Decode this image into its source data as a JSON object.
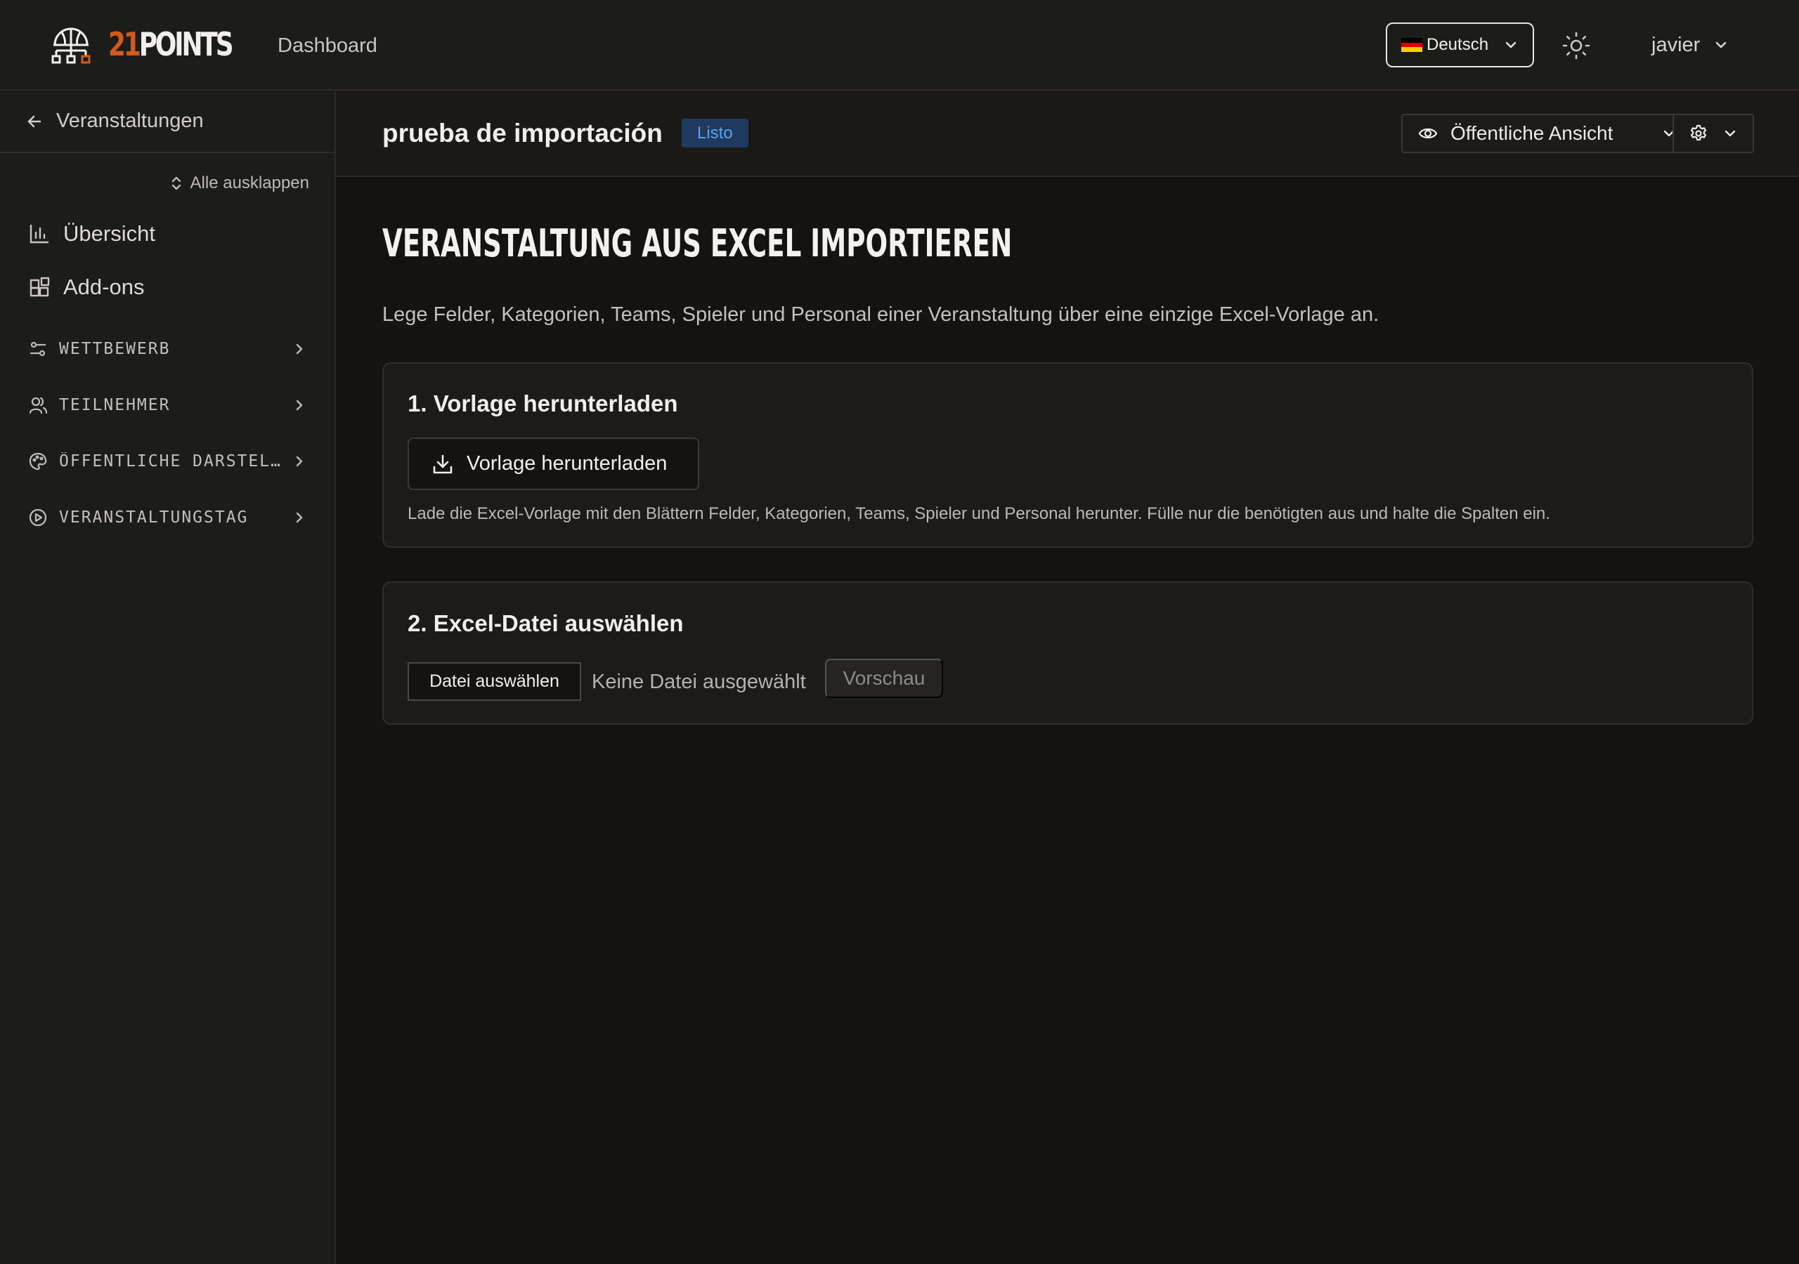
{
  "header": {
    "logo_number": "21",
    "logo_word": "POINTS",
    "nav_dashboard": "Dashboard",
    "language": "Deutsch",
    "user_name": "javier",
    "icons": {
      "logo": "basketball-bracket-icon",
      "theme": "sun-icon",
      "chevron": "chevron-down-icon"
    }
  },
  "sidebar": {
    "back_label": "Veranstaltungen",
    "expand_all": "Alle ausklappen",
    "items": [
      {
        "label": "Übersicht",
        "icon": "bar-chart-icon"
      },
      {
        "label": "Add-ons",
        "icon": "grid-plus-icon"
      }
    ],
    "groups": [
      {
        "label": "WETTBEWERB",
        "icon": "sliders-icon"
      },
      {
        "label": "TEILNEHMER",
        "icon": "users-icon"
      },
      {
        "label": "ÖFFENTLICHE DARSTEL…",
        "icon": "palette-icon"
      },
      {
        "label": "VERANSTALTUNGSTAG",
        "icon": "play-circle-icon"
      }
    ]
  },
  "subheader": {
    "event_title": "prueba de importación",
    "status_badge": "Listo",
    "public_view_label": "Öffentliche Ansicht"
  },
  "main": {
    "heading": "VERANSTALTUNG AUS EXCEL IMPORTIEREN",
    "description": "Lege Felder, Kategorien, Teams, Spieler und Personal einer Veranstaltung über eine einzige Excel-Vorlage an.",
    "step1": {
      "title": "1. Vorlage herunterladen",
      "button": "Vorlage herunterladen",
      "note": "Lade die Excel-Vorlage mit den Blättern Felder, Kategorien, Teams, Spieler und Personal herunter. Fülle nur die benötigten aus und halte die Spalten ein."
    },
    "step2": {
      "title": "2. Excel-Datei auswählen",
      "file_button": "Datei auswählen",
      "file_status": "Keine Datei ausgewählt",
      "preview_button": "Vorschau"
    }
  },
  "colors": {
    "background": "#141311",
    "surface": "#1c1c1b",
    "brand_orange": "#d35a1c",
    "badge_bg": "#1f3a5e",
    "badge_text": "#5fa0ee"
  }
}
